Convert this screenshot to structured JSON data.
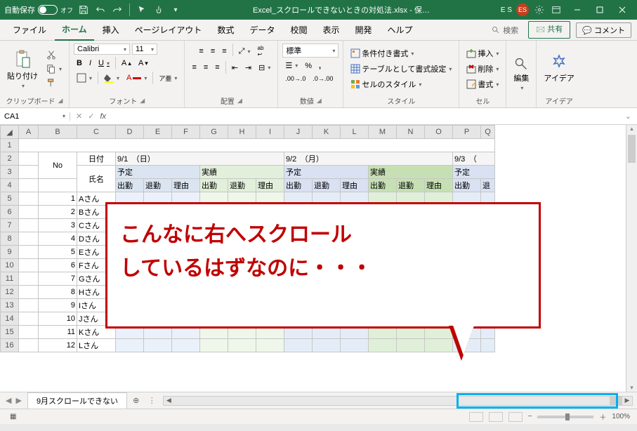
{
  "titlebar": {
    "autosave_label": "自動保存",
    "autosave_state": "オフ",
    "filename": "Excel_スクロールできないときの対処法.xlsx - 保…",
    "user_initials_text": "E S",
    "user_badge": "ES"
  },
  "tabs": {
    "file": "ファイル",
    "home": "ホーム",
    "insert": "挿入",
    "pagelayout": "ページレイアウト",
    "formulas": "数式",
    "data": "データ",
    "review": "校閲",
    "view": "表示",
    "developer": "開発",
    "help": "ヘルプ",
    "search": "検索",
    "share": "共有",
    "comment": "コメント"
  },
  "ribbon": {
    "clipboard": {
      "paste": "貼り付け",
      "label": "クリップボード"
    },
    "font": {
      "name": "Calibri",
      "size": "11",
      "b": "B",
      "i": "I",
      "u": "U",
      "label": "フォント"
    },
    "align": {
      "label": "配置"
    },
    "number": {
      "format": "標準",
      "label": "数値"
    },
    "styles": {
      "cond": "条件付き書式",
      "table": "テーブルとして書式設定",
      "cell": "セルのスタイル",
      "label": "スタイル"
    },
    "cells": {
      "insert": "挿入",
      "delete": "削除",
      "format": "書式",
      "label": "セル"
    },
    "editing": {
      "label": "編集"
    },
    "ideas": {
      "btn": "アイデア",
      "label": "アイデア"
    }
  },
  "namebox": {
    "ref": "CA1"
  },
  "columns": [
    "A",
    "B",
    "C",
    "D",
    "E",
    "F",
    "G",
    "H",
    "I",
    "J",
    "K",
    "L",
    "M",
    "N",
    "O",
    "P",
    "Q"
  ],
  "headers": {
    "no": "No",
    "date": "日付",
    "name": "氏名",
    "d1": "9/1",
    "d1w": "（日）",
    "d2": "9/2",
    "d2w": "（月）",
    "d3": "9/3",
    "d3w": "（",
    "yotei": "予定",
    "jisseki": "実績",
    "shukkin": "出勤",
    "taikin": "退勤",
    "riyuu": "理由"
  },
  "rows": [
    {
      "no": "1",
      "name": "Aさん"
    },
    {
      "no": "2",
      "name": "Bさん"
    },
    {
      "no": "3",
      "name": "Cさん"
    },
    {
      "no": "4",
      "name": "Dさん"
    },
    {
      "no": "5",
      "name": "Eさん"
    },
    {
      "no": "6",
      "name": "Fさん"
    },
    {
      "no": "7",
      "name": "Gさん"
    },
    {
      "no": "8",
      "name": "Hさん"
    },
    {
      "no": "9",
      "name": "Iさん"
    },
    {
      "no": "10",
      "name": "Jさん"
    },
    {
      "no": "11",
      "name": "Kさん"
    },
    {
      "no": "12",
      "name": "Lさん"
    }
  ],
  "callout": {
    "line1": "こんなに右へスクロール",
    "line2": "しているはずなのに・・・"
  },
  "sheettabs": {
    "tab1": "9月スクロールできない"
  },
  "statusbar": {
    "zoom": "100%"
  }
}
